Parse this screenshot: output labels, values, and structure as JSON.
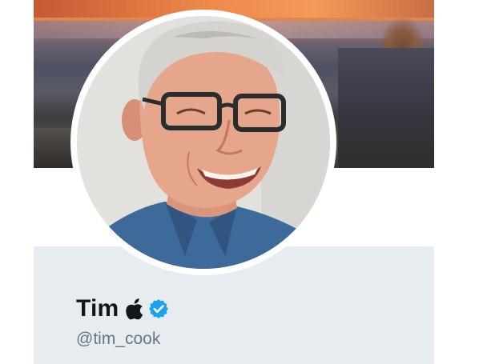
{
  "profile": {
    "display_name": "Tim",
    "handle": "@tim_cook",
    "name_emoji_icon": "apple-logo-icon",
    "verified_icon": "verified-badge-icon"
  },
  "colors": {
    "verified_blue": "#1da1f2",
    "name_text": "#14171a",
    "handle_text": "#657786",
    "panel_background": "#e7ecf0"
  }
}
